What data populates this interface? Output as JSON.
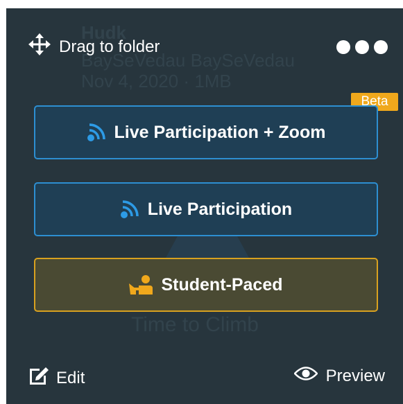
{
  "background": {
    "title": "Hudk",
    "author": "BaySeVedau BaySeVedau",
    "date": "Nov 4, 2020 · 1MB",
    "deck_name": "Time to Climb"
  },
  "toolbar": {
    "drag_label": "Drag to folder",
    "drag_icon": "move-arrows-icon",
    "more_icon": "more-dots-icon"
  },
  "badge": {
    "beta_label": "Beta"
  },
  "modes": {
    "zoom_label": "Live Participation + Zoom",
    "live_label": "Live Participation",
    "student_label": "Student-Paced"
  },
  "actions": {
    "edit_label": "Edit",
    "preview_label": "Preview"
  },
  "colors": {
    "card_bg": "#27353d",
    "live_border": "#2d8fd2",
    "live_icon": "#2d9be6",
    "student_border": "#d9a21f",
    "student_icon": "#f0a81c",
    "beta_bg": "#f0a81c"
  }
}
